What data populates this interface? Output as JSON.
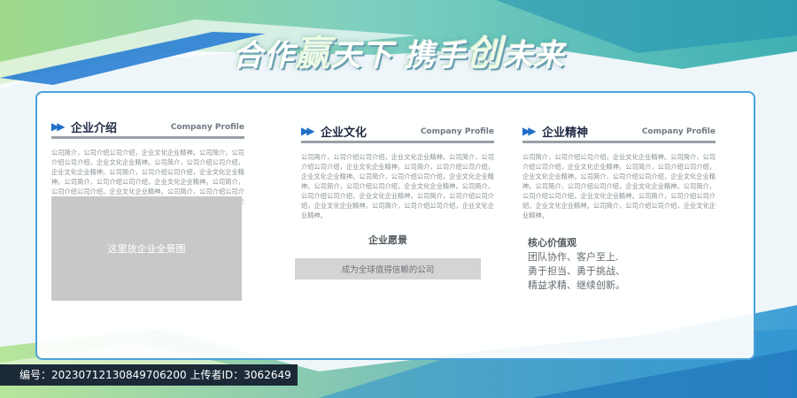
{
  "banner": {
    "title_part1": "合作",
    "title_big1": "赢",
    "title_part2": "天下 携手",
    "title_big2": "创",
    "title_part3": "未来"
  },
  "columns": [
    {
      "title": "企业介绍",
      "subtitle": "Company Profile",
      "body": "公司简介，公司介绍公司介绍，企业文化企业精神。公司简介，公司介绍公司介绍，企业文化企业精神。公司简介，公司介绍公司介绍，企业文化企业精神。公司简介，公司介绍公司介绍，企业文化企业精神。公司简介，公司介绍公司介绍，企业文化企业精神。公司简介，公司介绍公司介绍，企业文化企业精神。公司简介，公司介绍公司介绍，企业文化企业精神。公司简介，公司介绍公司介绍，企业文化企业精神。"
    },
    {
      "title": "企业文化",
      "subtitle": "Company Profile",
      "body": "公司简介，公司介绍公司介绍，企业文化企业精神。公司简介，公司介绍公司介绍，企业文化企业精神。公司简介，公司介绍公司介绍，企业文化企业精神。公司简介，公司介绍公司介绍，企业文化企业精神。公司简介，公司介绍公司介绍，企业文化企业精神。公司简介，公司介绍公司介绍，企业文化企业精神。公司简介，公司介绍公司介绍，企业文化企业精神。公司简介，公司介绍公司介绍，企业文化企业精神。"
    },
    {
      "title": "企业精神",
      "subtitle": "Company Profile",
      "body": "公司简介，公司介绍公司介绍，企业文化企业精神。公司简介，公司介绍公司介绍，企业文化企业精神。公司简介，公司介绍公司介绍，企业文化企业精神。公司简介，公司介绍公司介绍，企业文化企业精神。公司简介，公司介绍公司介绍，企业文化企业精神。公司简介，公司介绍公司介绍，企业文化企业精神。公司简介，公司介绍公司介绍，企业文化企业精神。公司简介，公司介绍公司介绍，企业文化企业精神。"
    }
  ],
  "photo_placeholder": "这里放企业全景图",
  "vision": {
    "title": "企业愿景",
    "text": "成为全球值得信赖的公司"
  },
  "values": {
    "title": "核心价值观",
    "lines": [
      "团队协作、客户至上.",
      "勇于担当、勇于挑战、",
      "精益求精、继续创新。"
    ]
  },
  "footer": {
    "text": "编号：20230712130849706200  上传者ID：3062649"
  },
  "colors": {
    "accent_blue": "#1e6fc8",
    "panel_border": "#4aa3d6",
    "green": "#8fd37a",
    "teal": "#3fb0b3",
    "footer_bg": "#1c2a38"
  }
}
